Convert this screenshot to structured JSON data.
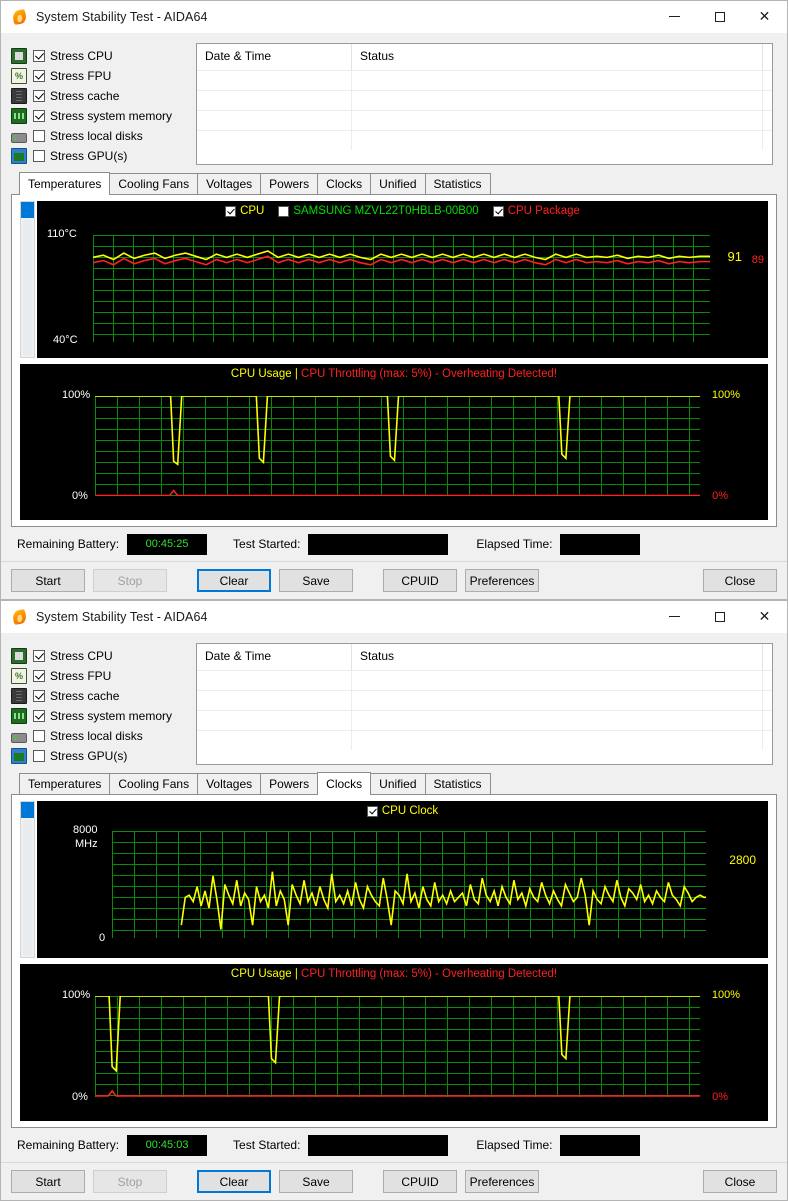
{
  "app": {
    "title": "System Stability Test - AIDA64",
    "icon": "flame-icon"
  },
  "window_controls": {
    "minimize": "minimize-icon",
    "maximize": "maximize-icon",
    "close": "close-icon"
  },
  "stress_options": [
    {
      "label": "Stress CPU",
      "checked": true,
      "icon": "cpu-icon"
    },
    {
      "label": "Stress FPU",
      "checked": true,
      "icon": "fpu-icon"
    },
    {
      "label": "Stress cache",
      "checked": true,
      "icon": "cache-icon"
    },
    {
      "label": "Stress system memory",
      "checked": true,
      "icon": "memory-icon"
    },
    {
      "label": "Stress local disks",
      "checked": false,
      "icon": "disk-icon"
    },
    {
      "label": "Stress GPU(s)",
      "checked": false,
      "icon": "gpu-icon"
    }
  ],
  "log_table": {
    "columns": [
      "Date & Time",
      "Status"
    ],
    "rows": []
  },
  "tabs": [
    "Temperatures",
    "Cooling Fans",
    "Voltages",
    "Powers",
    "Clocks",
    "Unified",
    "Statistics"
  ],
  "window_top": {
    "active_tab": "Temperatures",
    "temperature_chart": {
      "legend": [
        {
          "label": "CPU",
          "checked": true,
          "color": "#ffff00"
        },
        {
          "label": "SAMSUNG MZVL22T0HBLB-00B00",
          "checked": false,
          "color": "#00e000"
        },
        {
          "label": "CPU Package",
          "checked": true,
          "color": "#ff2020"
        }
      ],
      "y_top": "110°C",
      "y_bottom": "40°C",
      "value_cpu": "91",
      "value_package": "89"
    },
    "usage_chart": {
      "title_main": "CPU Usage",
      "title_sep": "|",
      "title_warn": "CPU Throttling (max: 5%) - Overheating Detected!",
      "y_top_left": "100%",
      "y_bottom_left": "0%",
      "y_top_right": "100%",
      "y_bottom_right": "0%"
    },
    "status": {
      "battery_label": "Remaining Battery:",
      "battery_value": "00:45:25",
      "started_label": "Test Started:",
      "started_value": "",
      "elapsed_label": "Elapsed Time:",
      "elapsed_value": ""
    },
    "buttons": {
      "start": "Start",
      "stop": "Stop",
      "clear": "Clear",
      "save": "Save",
      "cpuid": "CPUID",
      "preferences": "Preferences",
      "close": "Close"
    }
  },
  "window_bottom": {
    "active_tab": "Clocks",
    "clock_chart": {
      "legend": [
        {
          "label": "CPU Clock",
          "checked": true,
          "color": "#ffff00"
        }
      ],
      "y_top": "8000",
      "y_top_unit": "MHz",
      "y_bottom": "0",
      "value_clock": "2800"
    },
    "usage_chart": {
      "title_main": "CPU Usage",
      "title_sep": "|",
      "title_warn": "CPU Throttling (max: 5%) - Overheating Detected!",
      "y_top_left": "100%",
      "y_bottom_left": "0%",
      "y_top_right": "100%",
      "y_bottom_right": "0%"
    },
    "status": {
      "battery_label": "Remaining Battery:",
      "battery_value": "00:45:03",
      "started_label": "Test Started:",
      "started_value": "",
      "elapsed_label": "Elapsed Time:",
      "elapsed_value": ""
    },
    "buttons": {
      "start": "Start",
      "stop": "Stop",
      "clear": "Clear",
      "save": "Save",
      "cpuid": "CPUID",
      "preferences": "Preferences",
      "close": "Close"
    }
  },
  "colors": {
    "accent": "#0078d7",
    "grid_green": "#0a8a0a",
    "trace_yellow": "#ffff00",
    "trace_red": "#ff2020",
    "plot_bg": "#000000"
  },
  "chart_data": [
    {
      "type": "line",
      "title": "CPU Temperatures",
      "ylabel": "°C",
      "ylim": [
        40,
        110
      ],
      "grid": true,
      "legend_position": "top-center",
      "series": [
        {
          "name": "CPU",
          "color": "#ffff00",
          "visible": true,
          "last_value": 91,
          "values": [
            92,
            91,
            93,
            90,
            92,
            91,
            90,
            92,
            91,
            90,
            91,
            92,
            90,
            91,
            90,
            91,
            90,
            89,
            91,
            90,
            91,
            90,
            91,
            90,
            91,
            90,
            91,
            92,
            90,
            91,
            90,
            91,
            90,
            91,
            90,
            91,
            90,
            91,
            90,
            91,
            90,
            91,
            90,
            91,
            92,
            90,
            91,
            90,
            91,
            91
          ]
        },
        {
          "name": "SAMSUNG MZVL22T0HBLB-00B00",
          "color": "#00e000",
          "visible": false,
          "last_value": null,
          "values": []
        },
        {
          "name": "CPU Package",
          "color": "#ff2020",
          "visible": true,
          "last_value": 89,
          "values": [
            90,
            89,
            91,
            88,
            90,
            89,
            88,
            90,
            89,
            88,
            89,
            90,
            88,
            89,
            88,
            89,
            88,
            87,
            89,
            88,
            89,
            88,
            89,
            88,
            89,
            88,
            89,
            90,
            88,
            89,
            88,
            89,
            88,
            89,
            88,
            89,
            88,
            89,
            88,
            89,
            88,
            89,
            88,
            89,
            90,
            88,
            89,
            88,
            89,
            89
          ]
        }
      ]
    },
    {
      "type": "line",
      "title": "CPU Usage / CPU Throttling",
      "ylabel": "%",
      "ylim": [
        0,
        100
      ],
      "grid": true,
      "annotation": "CPU Throttling (max: 5%) - Overheating Detected!",
      "series": [
        {
          "name": "CPU Usage",
          "color": "#ffff00",
          "last_value": 100,
          "values": [
            100,
            100,
            100,
            100,
            100,
            100,
            100,
            100,
            100,
            35,
            100,
            100,
            100,
            100,
            100,
            100,
            100,
            100,
            100,
            100,
            100,
            100,
            100,
            100,
            30,
            100,
            100,
            100,
            100,
            100,
            100,
            100,
            100,
            100,
            100,
            100,
            100,
            100,
            100,
            100,
            28,
            100,
            100,
            100,
            100,
            100,
            100,
            100,
            100,
            100,
            100,
            100,
            100,
            100,
            100,
            100,
            100,
            100,
            100,
            100,
            32,
            100,
            100,
            100,
            100,
            100,
            100,
            100,
            100,
            100
          ]
        },
        {
          "name": "CPU Throttling",
          "color": "#ff2020",
          "last_value": 0,
          "values": [
            0,
            0,
            0,
            0,
            0,
            0,
            0,
            0,
            0,
            5,
            0,
            0,
            0,
            0,
            0,
            0,
            0,
            0,
            0,
            0,
            0,
            0,
            0,
            0,
            0,
            0,
            0,
            0,
            0,
            0,
            0,
            0,
            0,
            0,
            0,
            0,
            0,
            0,
            0,
            0,
            0,
            0,
            0,
            0,
            0,
            0,
            0,
            0,
            0,
            0,
            0,
            0,
            0,
            0,
            0,
            0,
            0,
            0,
            0,
            0,
            0,
            0,
            0,
            0,
            0,
            0,
            0,
            0,
            0,
            0
          ]
        }
      ]
    },
    {
      "type": "line",
      "title": "CPU Clock",
      "ylabel": "MHz",
      "ylim": [
        0,
        8000
      ],
      "grid": true,
      "legend_position": "top-center",
      "series": [
        {
          "name": "CPU Clock",
          "color": "#ffff00",
          "visible": true,
          "last_value": 2800,
          "values": [
            2400,
            3000,
            3100,
            2800,
            3300,
            2600,
            3200,
            2500,
            3600,
            2900,
            2300,
            3400,
            3000,
            2700,
            3500,
            2600,
            3100,
            2900,
            2400,
            3300,
            2800,
            3000,
            2500,
            3700,
            2600,
            3200,
            2900,
            2400,
            3400,
            3000,
            2700,
            3500,
            2800,
            3100,
            2600,
            3300,
            2900,
            2500,
            3600,
            2800,
            3000,
            2700,
            3200,
            2600,
            3400,
            2900,
            2500,
            3300,
            3000,
            2800,
            2600,
            3500,
            2900,
            2400,
            3200,
            3000,
            2700,
            3600,
            2800,
            3100,
            2500,
            3300,
            2900,
            2600,
            3400,
            2800,
            3000,
            2700,
            3200,
            2800
          ]
        }
      ]
    },
    {
      "type": "line",
      "title": "CPU Usage / CPU Throttling",
      "ylabel": "%",
      "ylim": [
        0,
        100
      ],
      "grid": true,
      "annotation": "CPU Throttling (max: 5%) - Overheating Detected!",
      "series": [
        {
          "name": "CPU Usage",
          "color": "#ffff00",
          "last_value": 100,
          "values": [
            100,
            100,
            30,
            100,
            100,
            100,
            100,
            100,
            100,
            100,
            100,
            100,
            100,
            100,
            100,
            100,
            100,
            28,
            100,
            100,
            100,
            100,
            100,
            100,
            100,
            100,
            100,
            100,
            100,
            100,
            100,
            100,
            100,
            100,
            100,
            100,
            100,
            100,
            100,
            100,
            100,
            100,
            100,
            32,
            100,
            100,
            100,
            100,
            100,
            100,
            100,
            100,
            100,
            100,
            100,
            100,
            100,
            100,
            100,
            100,
            100,
            100,
            100,
            100,
            100,
            100,
            100,
            100,
            100,
            100
          ]
        },
        {
          "name": "CPU Throttling",
          "color": "#ff2020",
          "last_value": 0,
          "values": [
            0,
            0,
            0,
            0,
            0,
            0,
            0,
            0,
            0,
            0,
            0,
            0,
            0,
            0,
            0,
            0,
            0,
            0,
            0,
            0,
            0,
            0,
            0,
            0,
            0,
            0,
            0,
            0,
            0,
            0,
            0,
            0,
            0,
            0,
            0,
            0,
            0,
            0,
            0,
            0,
            0,
            0,
            0,
            0,
            0,
            0,
            0,
            0,
            0,
            0,
            0,
            0,
            0,
            0,
            0,
            0,
            0,
            0,
            0,
            0,
            0,
            0,
            0,
            0,
            0,
            0,
            0,
            0,
            0,
            0
          ]
        }
      ]
    }
  ]
}
